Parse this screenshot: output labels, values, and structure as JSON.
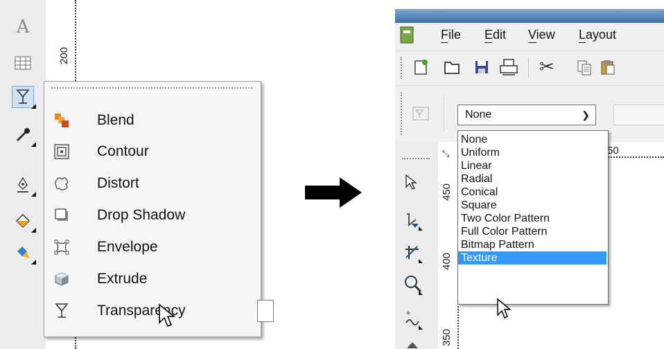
{
  "left_panel": {
    "ruler_label": "200",
    "flyout_items": [
      {
        "label": "Blend",
        "icon": "blend-icon"
      },
      {
        "label": "Contour",
        "icon": "contour-icon"
      },
      {
        "label": "Distort",
        "icon": "distort-icon"
      },
      {
        "label": "Drop Shadow",
        "icon": "drop-shadow-icon"
      },
      {
        "label": "Envelope",
        "icon": "envelope-icon"
      },
      {
        "label": "Extrude",
        "icon": "extrude-icon"
      },
      {
        "label": "Transparency",
        "icon": "transparency-icon"
      }
    ],
    "toolbox_icons": [
      "text-tool-icon",
      "table-tool-icon",
      "interactive-effects-icon",
      "eyedropper-icon",
      "outline-pen-icon",
      "fill-icon",
      "interactive-fill-icon"
    ]
  },
  "right_panel": {
    "menu": [
      "File",
      "Edit",
      "View",
      "Layout"
    ],
    "transparency_type": {
      "selected": "None",
      "options": [
        "None",
        "Uniform",
        "Linear",
        "Radial",
        "Conical",
        "Square",
        "Two Color Pattern",
        "Full Color Pattern",
        "Bitmap Pattern",
        "Texture"
      ],
      "highlighted": "Texture"
    },
    "ruler_labels": {
      "h": "50",
      "v1": "450",
      "v2": "400",
      "v3": "350"
    }
  },
  "colors": {
    "highlight": "#3399ff",
    "selected_tool": "#cfe1f5"
  }
}
